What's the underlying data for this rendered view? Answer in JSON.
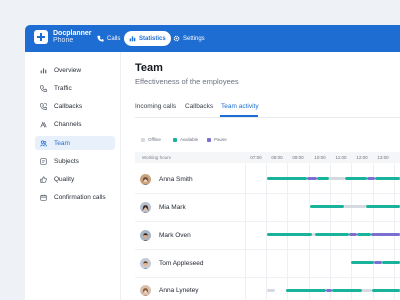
{
  "app": {
    "name": "Docplanner",
    "sub": "Phone"
  },
  "topnav": [
    {
      "label": "Calls",
      "icon": "phone-icon",
      "active": false
    },
    {
      "label": "Statistics",
      "icon": "bar-chart-icon",
      "active": true
    },
    {
      "label": "Settings",
      "icon": "gear-icon",
      "active": false
    }
  ],
  "sidebar": {
    "items": [
      {
        "label": "Overview",
        "icon": "bar-chart-icon",
        "active": false
      },
      {
        "label": "Traffic",
        "icon": "phone-icon",
        "active": false
      },
      {
        "label": "Callbacks",
        "icon": "callback-icon",
        "active": false
      },
      {
        "label": "Channels",
        "icon": "channels-icon",
        "active": false
      },
      {
        "label": "Team",
        "icon": "team-icon",
        "active": true
      },
      {
        "label": "Subjects",
        "icon": "subjects-icon",
        "active": false
      },
      {
        "label": "Quality",
        "icon": "thumbs-up-icon",
        "active": false
      },
      {
        "label": "Confirmation calls",
        "icon": "calendar-icon",
        "active": false
      }
    ]
  },
  "page": {
    "title": "Team",
    "subtitle": "Effectiveness of the employees"
  },
  "tabs": [
    {
      "label": "Incoming calls",
      "active": false
    },
    {
      "label": "Callbacks",
      "active": false
    },
    {
      "label": "Team activity",
      "active": true
    }
  ],
  "legend": [
    {
      "label": "Offline",
      "color": "#d5d9e0"
    },
    {
      "label": "Available",
      "color": "#18b39a"
    },
    {
      "label": "Pause",
      "color": "#7b6fd0"
    }
  ],
  "table": {
    "header_label": "Working hours",
    "times": [
      "07:00",
      "08:00",
      "09:00",
      "10:00",
      "11:00",
      "12:00",
      "13:00"
    ]
  },
  "people": [
    {
      "name": "Anna Smith"
    },
    {
      "name": "Mia Mark"
    },
    {
      "name": "Mark Oven"
    },
    {
      "name": "Tom Appleseed"
    },
    {
      "name": "Anna Lynetey"
    }
  ],
  "colors": {
    "brand": "#1e6dd2",
    "available": "#18b39a",
    "pause": "#7b6fd0",
    "offline": "#d5d9e0"
  }
}
